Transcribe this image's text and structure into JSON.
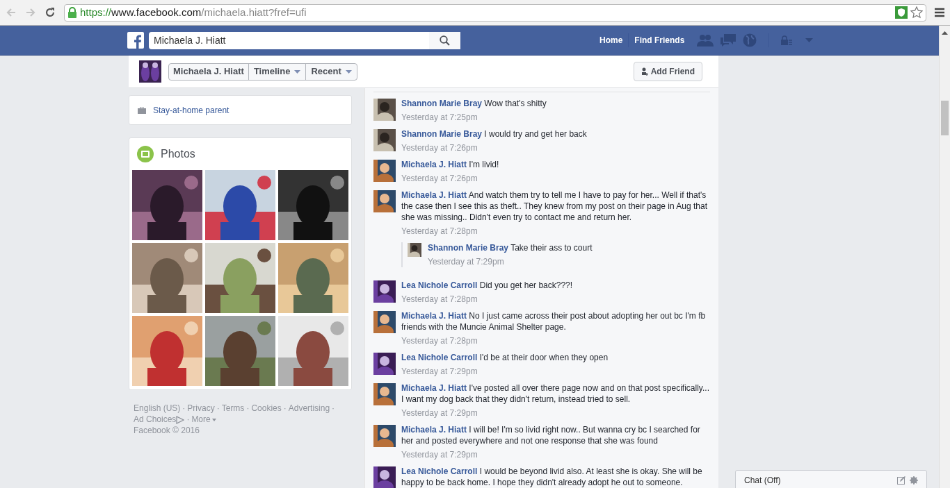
{
  "browser": {
    "url_scheme": "https://",
    "url_host": "www.facebook.com",
    "url_path": "/michaela.hiatt?fref=ufi"
  },
  "topbar": {
    "search_value": "Michaela J. Hiatt",
    "nav": [
      "Home",
      "Find Friends"
    ]
  },
  "profile_header": {
    "name": "Michaela J. Hiatt",
    "tabs": [
      {
        "label": "Timeline"
      },
      {
        "label": "Recent"
      }
    ],
    "add_friend": "Add Friend"
  },
  "intro": {
    "work": "Stay-at-home parent"
  },
  "photos": {
    "title": "Photos"
  },
  "footer": {
    "links": [
      "English (US)",
      "Privacy",
      "Terms",
      "Cookies",
      "Advertising",
      "Ad Choices",
      "More"
    ],
    "separator": "·",
    "copyright": "Facebook © 2016"
  },
  "comments": [
    {
      "kind": "comment",
      "author": "Shannon Marie Bray",
      "text": "Wow that's shitty",
      "time": "Yesterday at 7:25pm"
    },
    {
      "kind": "comment",
      "author": "Shannon Marie Bray",
      "text": "I would try and get her back",
      "time": "Yesterday at 7:26pm"
    },
    {
      "kind": "comment",
      "author": "Michaela J. Hiatt",
      "text": "I'm livid!",
      "time": "Yesterday at 7:26pm"
    },
    {
      "kind": "comment",
      "author": "Michaela J. Hiatt",
      "text": "And watch them try to tell me I have to pay for her... Well if that's the case then I see this as theft.. They knew from my post on their page in Aug that she was missing.. Didn't even try to contact me and return her.",
      "time": "Yesterday at 7:28pm"
    },
    {
      "kind": "reply",
      "author": "Shannon Marie Bray",
      "text": "Take their ass to court",
      "time": "Yesterday at 7:29pm"
    },
    {
      "kind": "comment",
      "author": "Lea Nichole Carroll",
      "text": "Did you get her back???!",
      "time": "Yesterday at 7:28pm"
    },
    {
      "kind": "comment",
      "author": "Michaela J. Hiatt",
      "text": "No I just came across their post about adopting her out bc I'm fb friends with the Muncie Animal Shelter page.",
      "time": "Yesterday at 7:28pm"
    },
    {
      "kind": "comment",
      "author": "Lea Nichole Carroll",
      "text": "I'd be at their door when they open",
      "time": "Yesterday at 7:29pm"
    },
    {
      "kind": "comment",
      "author": "Michaela J. Hiatt",
      "text": "I've posted all over there page now and on that post specifically... I want my dog back that they didn't return, instead tried to sell.",
      "time": "Yesterday at 7:29pm"
    },
    {
      "kind": "comment",
      "author": "Michaela J. Hiatt",
      "text": "I will be! I'm so livid right now.. But wanna cry bc I searched for her and posted everywhere and not one response that she was found",
      "time": "Yesterday at 7:29pm"
    },
    {
      "kind": "comment",
      "author": "Lea Nichole Carroll",
      "text": "I would be beyond livid also. At least she is okay. She will be happy to be back home. I hope they didn't already adopt he out to someone."
    }
  ],
  "chat": {
    "label": "Chat (Off)"
  }
}
